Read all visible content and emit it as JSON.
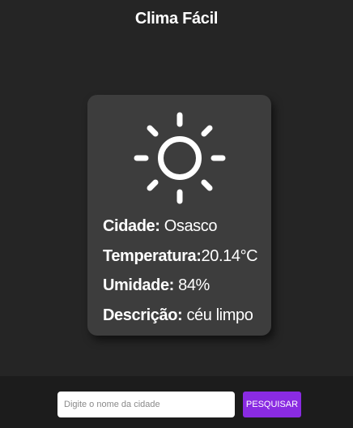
{
  "header": {
    "title": "Clima Fácil"
  },
  "weather": {
    "icon": "sun-icon",
    "city_label": "Cidade:",
    "city_value": " Osasco",
    "temperature_label": "Temperatura:",
    "temperature_value": "20.14°C",
    "humidity_label": "Umidade:",
    "humidity_value": " 84%",
    "description_label": "Descrição:",
    "description_value": " céu limpo"
  },
  "search": {
    "placeholder": "Digite o nome da cidade",
    "value": "",
    "button_label": "PESQUISAR"
  },
  "colors": {
    "background": "#252525",
    "card": "#3d3d3d",
    "footer": "#1c1c1c",
    "accent": "#8a2be2"
  }
}
